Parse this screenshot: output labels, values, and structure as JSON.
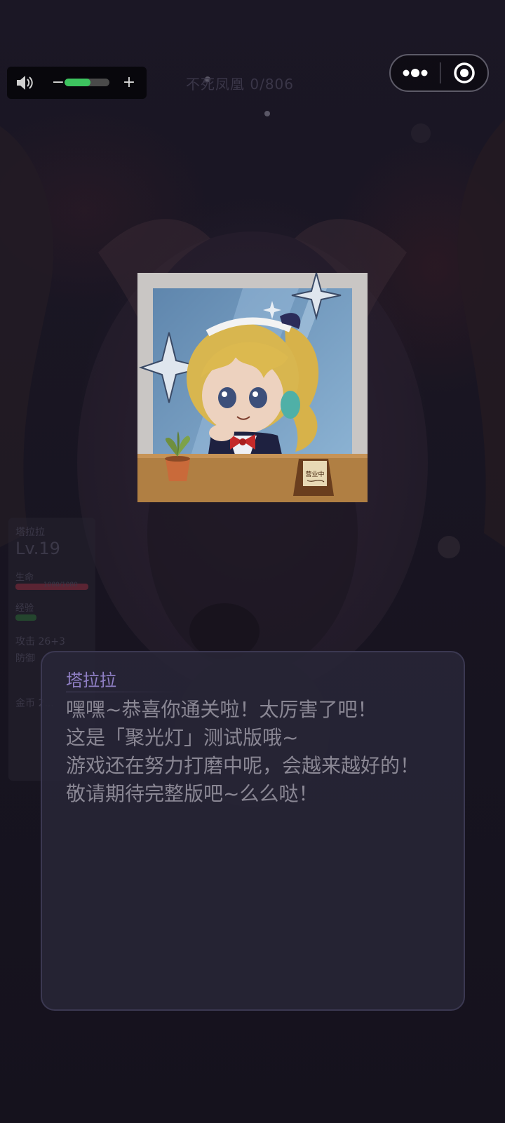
{
  "top_bar": {
    "level_title": "不死凤凰 0/806",
    "volume": {
      "minus_label": "−",
      "plus_label": "+",
      "level_fraction": 0.58,
      "fill_color": "#3dc45f"
    },
    "capsule": {
      "more_icon": "more-dots-icon",
      "close_icon": "target-close-icon"
    }
  },
  "status_panel": {
    "name": "塔拉拉",
    "level": "Lv.19",
    "hp_label": "生命",
    "hp_value": "1080/1080",
    "exp_label": "经验",
    "attack": "攻击 26+3",
    "defense": "防御",
    "gold": "金币 2...",
    "hp_color": "#5a2433",
    "exp_color": "#24452e"
  },
  "portrait": {
    "icon": "maid-girl-portrait",
    "sign_text": "营业中"
  },
  "dialog": {
    "speaker": "塔拉拉",
    "lines": [
      "嘿嘿~恭喜你通关啦！太厉害了吧！",
      "这是「聚光灯」测试版哦~",
      "游戏还在努力打磨中呢，会越来越好的！",
      "敬请期待完整版吧~么么哒！"
    ]
  }
}
